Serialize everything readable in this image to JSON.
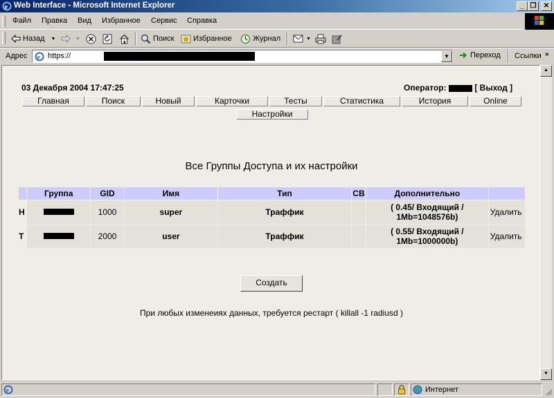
{
  "window": {
    "title": "Web Interface - Microsoft Internet Explorer"
  },
  "menu": [
    "Файл",
    "Правка",
    "Вид",
    "Избранное",
    "Сервис",
    "Справка"
  ],
  "toolbar": {
    "back": "Назад",
    "search": "Поиск",
    "favorites": "Избранное",
    "history": "Журнал"
  },
  "address": {
    "label": "Адрес",
    "url": "https://",
    "go": "Переход",
    "links": "Ссылки"
  },
  "page": {
    "datetime": "03 Декабря 2004 17:47:25",
    "operator_label": "Оператор:",
    "logout": "[ Выход ]",
    "nav": [
      "Главная",
      "Поиск",
      "Новый",
      "Карточки",
      "Тесты",
      "Статистика",
      "История",
      "Online"
    ],
    "nav2": "Настройки",
    "heading": "Все Группы Доступа и их настройки",
    "table": {
      "headers": [
        "",
        "Группа",
        "GID",
        "Имя",
        "Тип",
        "СВ",
        "Дополнительно",
        ""
      ],
      "rows": [
        {
          "flag": "H",
          "gid": "1000",
          "name": "super",
          "type": "Траффик",
          "extra1": "( 0.45/ Входящий /",
          "extra2": "1Mb=1048576b)",
          "action": "Удалить"
        },
        {
          "flag": "T",
          "gid": "2000",
          "name": "user",
          "type": "Траффик",
          "extra1": "( 0.55/ Входящий /",
          "extra2": "1Mb=1000000b)",
          "action": "Удалить"
        }
      ]
    },
    "create_button": "Создать",
    "notice": "При любых изменеиях данных, требуется рестарт ( killall -1 radiusd )"
  },
  "status": {
    "zone": "Интернет"
  }
}
